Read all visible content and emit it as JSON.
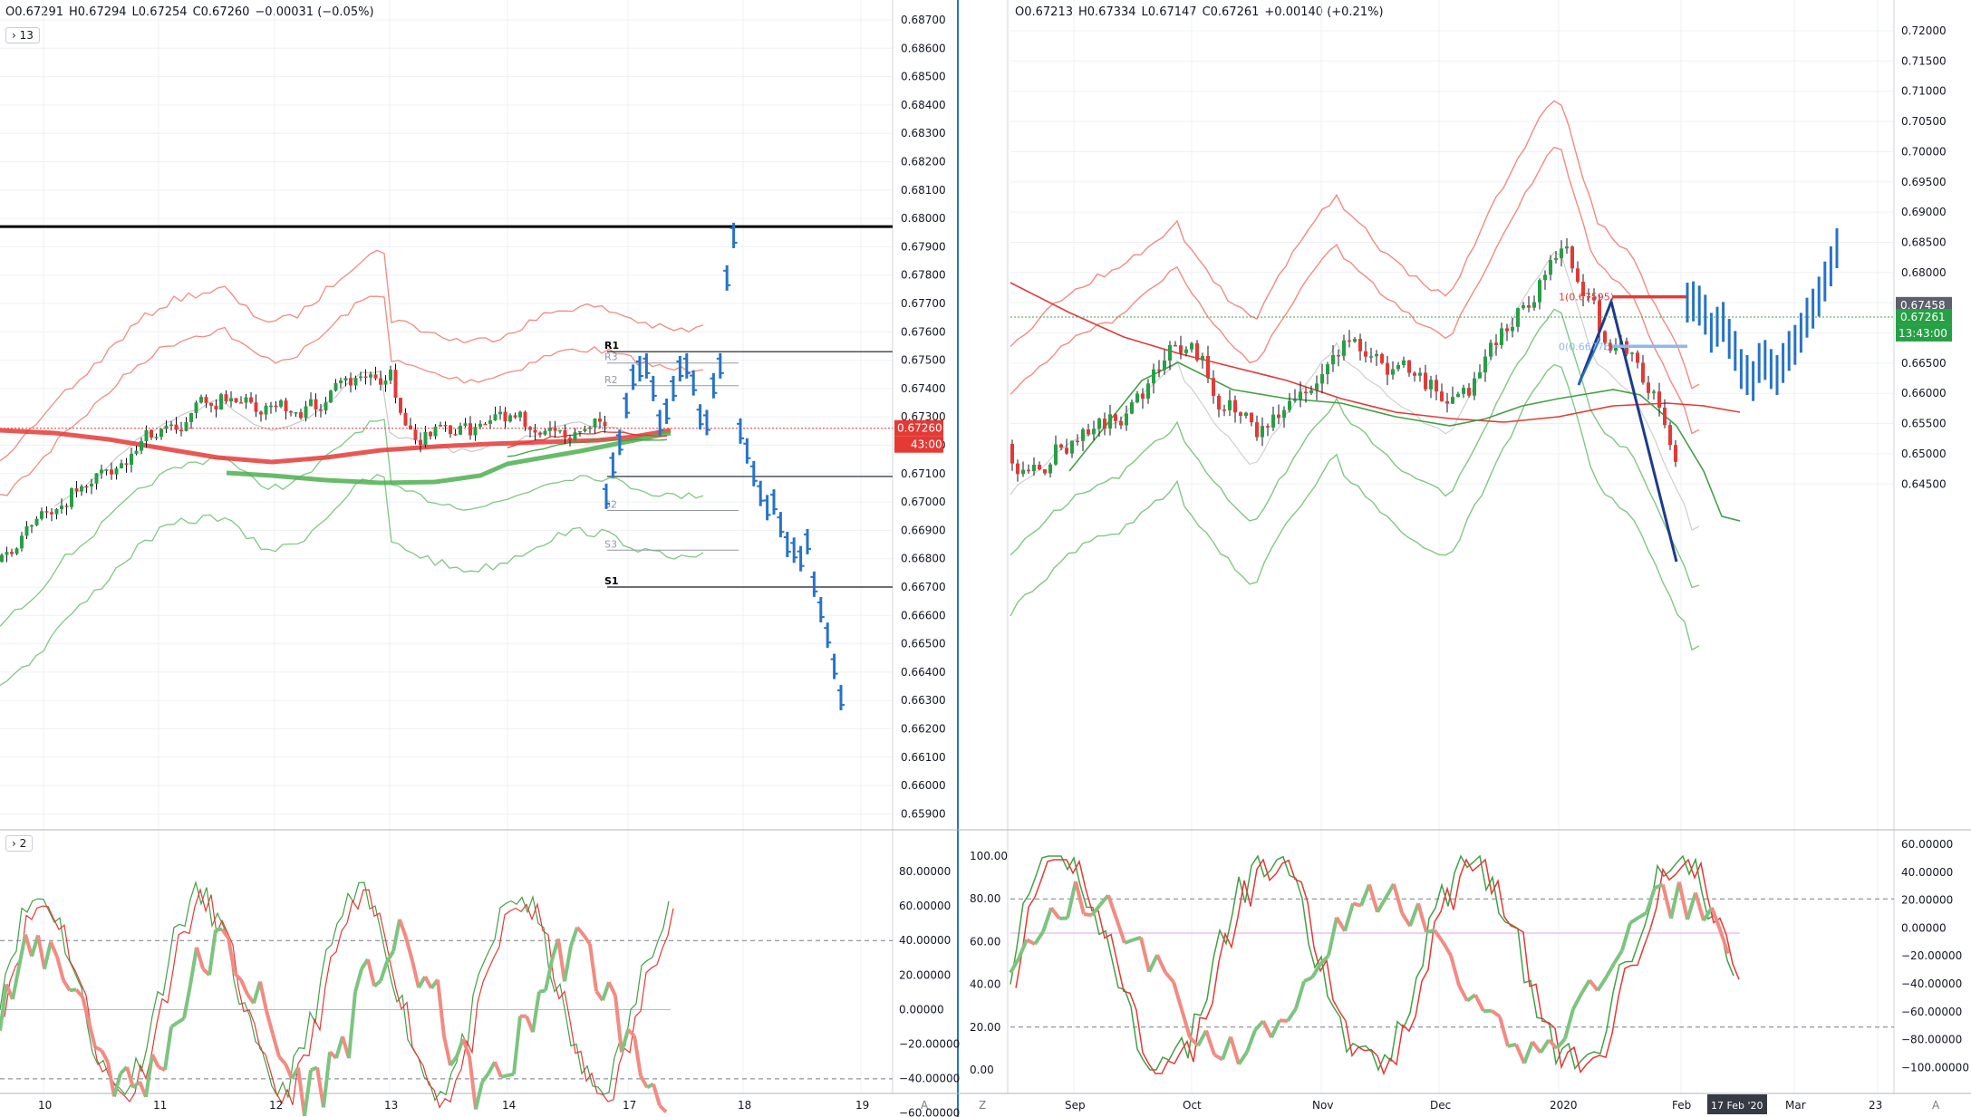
{
  "left_panel": {
    "ohlc": {
      "o": "O0.67291",
      "h": "H0.67294",
      "l": "L0.67254",
      "c": "C0.67260",
      "chg": "−0.00031 (−0.05%)"
    },
    "indicator_badge": "13",
    "price_ticks": [
      "0.68700",
      "0.68600",
      "0.68500",
      "0.68400",
      "0.68300",
      "0.68200",
      "0.68100",
      "0.68000",
      "0.67900",
      "0.67800",
      "0.67700",
      "0.67600",
      "0.67500",
      "0.67400",
      "0.67300",
      "0.67200",
      "0.67100",
      "0.67000",
      "0.66900",
      "0.66800",
      "0.66700",
      "0.66600",
      "0.66500",
      "0.66400",
      "0.66300",
      "0.66200",
      "0.66100",
      "0.66000",
      "0.65900"
    ],
    "last_price_label": "0.67260",
    "countdown_label": "43:00",
    "pivot_labels": {
      "r1": "R1",
      "r3": "R3",
      "r2": "R2",
      "s2": "S2",
      "s3": "S3",
      "s1": "S1"
    },
    "osc_badge": "2",
    "osc_ticks": [
      "80.00000",
      "60.00000",
      "40.00000",
      "20.00000",
      "0.00000",
      "−20.00000",
      "−40.00000",
      "−60.00000"
    ],
    "date_ticks": [
      "10",
      "11",
      "12",
      "13",
      "14",
      "17",
      "18",
      "19"
    ],
    "corner_label": "A"
  },
  "right_panel": {
    "ohlc": {
      "o": "O0.67213",
      "h": "H0.67334",
      "l": "L0.67147",
      "c": "C0.67261",
      "chg": "+0.00140 (+0.21%)"
    },
    "price_ticks": [
      "0.72000",
      "0.71500",
      "0.71000",
      "0.70500",
      "0.70000",
      "0.69500",
      "0.69000",
      "0.68500",
      "0.68000",
      "0.67500",
      "0.67000",
      "0.66500",
      "0.66000",
      "0.65500",
      "0.65000",
      "0.64500"
    ],
    "gray_label": "0.67458",
    "last_price_label": "0.67261",
    "countdown_label": "13:43:00",
    "fib_labels": {
      "f1": "1(0.67595)",
      "f0": "0(0.66776)"
    },
    "osc_left_ticks": [
      "100.00",
      "80.00",
      "60.00",
      "40.00",
      "20.00",
      "0.00"
    ],
    "osc_right_ticks": [
      "60.00000",
      "40.00000",
      "20.00000",
      "0.00000",
      "−20.00000",
      "−40.00000",
      "−60.00000",
      "−80.00000",
      "−100.00000"
    ],
    "date_ticks": [
      "Sep",
      "Oct",
      "Nov",
      "Dec",
      "2020",
      "Feb",
      "Mar",
      "23"
    ],
    "cursor_date": "17 Feb '20",
    "corner_left": "Z",
    "corner_right": "A"
  },
  "chart_data": [
    {
      "type": "line",
      "title": "",
      "ylim": [
        0.6585,
        0.6875
      ],
      "series": [
        {
          "color": "#2673c8",
          "values": [
            0.6702,
            0.6713,
            0.6721,
            0.6734,
            0.6744,
            0.6747,
            0.6748,
            0.674,
            0.6728,
            0.6732,
            0.674,
            0.6747,
            0.6748,
            0.6742,
            0.673,
            0.6728,
            0.6741,
            0.6748,
            0.6779,
            0.6794,
            0.6725,
            0.6718,
            0.671,
            0.6703,
            0.6698,
            0.67,
            0.6692,
            0.6685,
            0.6683,
            0.668,
            0.6686,
            0.6671,
            0.6662,
            0.6653,
            0.6642,
            0.6631
          ]
        },
        {
          "color": "#f28b82",
          "values": [
            0.674,
            0.6742,
            0.6745,
            0.675,
            0.6752,
            0.6755,
            0.6758,
            0.676,
            0.6758,
            0.6755,
            0.6752,
            0.675,
            0.6748,
            0.6748,
            0.6745,
            0.6742,
            0.674,
            0.6738
          ]
        },
        {
          "color": "#e53935",
          "values": [
            0.6724,
            0.6724,
            0.6723,
            0.6722,
            0.672,
            0.6718,
            0.6716,
            0.6714,
            0.6713,
            0.6713,
            0.6714,
            0.6715,
            0.6717,
            0.6718,
            0.6719,
            0.672,
            0.6722,
            0.6723
          ]
        },
        {
          "color": "#66bb6a",
          "values": [
            0.67,
            0.6702,
            0.6705,
            0.6708,
            0.671,
            0.6711,
            0.671,
            0.6709,
            0.6709,
            0.671,
            0.6711,
            0.6713,
            0.6715,
            0.6716,
            0.6718,
            0.6719,
            0.672,
            0.6721
          ]
        }
      ],
      "levels": {
        "black_line": 0.67971,
        "r1": 0.6753,
        "r3": 0.6749,
        "r2": 0.6741,
        "pivot": 0.6709,
        "s2": 0.6697,
        "s3": 0.6683,
        "s1": 0.667,
        "last": 0.6726
      }
    },
    {
      "type": "line",
      "title": "",
      "ylim": [
        0.642,
        0.723
      ],
      "series": [
        {
          "color": "#2673c8",
          "values": [
            0.675,
            0.6752,
            0.6745,
            0.673,
            0.67,
            0.671,
            0.6718,
            0.669,
            0.667,
            0.664,
            0.663,
            0.662,
            0.665,
            0.6655,
            0.664,
            0.663,
            0.665,
            0.667,
            0.668,
            0.67,
            0.6725,
            0.674,
            0.676,
            0.6785,
            0.681,
            0.684
          ]
        },
        {
          "color": "#e53935",
          "values": [
            0.6845,
            0.6843,
            0.6838,
            0.6834,
            0.683,
            0.6827,
            0.6824,
            0.6822,
            0.682,
            0.6821,
            0.6822
          ]
        },
        {
          "color": "#66bb6a",
          "values": [
            0.6815,
            0.6826,
            0.6835,
            0.684,
            0.6833,
            0.682,
            0.68,
            0.678,
            0.676,
            0.674,
            0.6725
          ]
        }
      ],
      "levels": {
        "fib_1": 0.67595,
        "fib_0": 0.66776,
        "gray": 0.67458,
        "last": 0.67261
      }
    }
  ]
}
